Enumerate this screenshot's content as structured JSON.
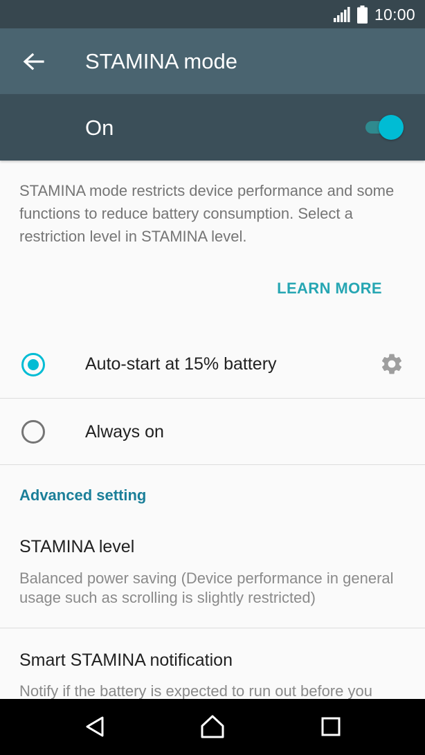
{
  "status_bar": {
    "time": "10:00",
    "icons": [
      "signal-icon",
      "battery-icon"
    ]
  },
  "app_bar": {
    "title": "STAMINA mode",
    "back_icon": "arrow-back-icon"
  },
  "master_switch": {
    "label": "On",
    "checked": true,
    "accent_color": "#00bcd4"
  },
  "description": "STAMINA mode restricts device performance and some functions to reduce battery consumption. Select a restriction level in STAMINA level.",
  "learn_more_label": "LEARN MORE",
  "options": [
    {
      "label": "Auto-start at 15% battery",
      "selected": true,
      "has_settings": true
    },
    {
      "label": "Always on",
      "selected": false,
      "has_settings": false
    }
  ],
  "advanced": {
    "header": "Advanced setting",
    "items": [
      {
        "title": "STAMINA level",
        "summary": "Balanced power saving (Device performance in general usage such as scrolling is slightly restricted)"
      },
      {
        "title": "Smart STAMINA notification",
        "summary": "Notify if the battery is expected to run out before you"
      }
    ]
  },
  "nav_bar": {
    "buttons": [
      "back-triangle-icon",
      "home-icon",
      "recents-icon"
    ]
  }
}
